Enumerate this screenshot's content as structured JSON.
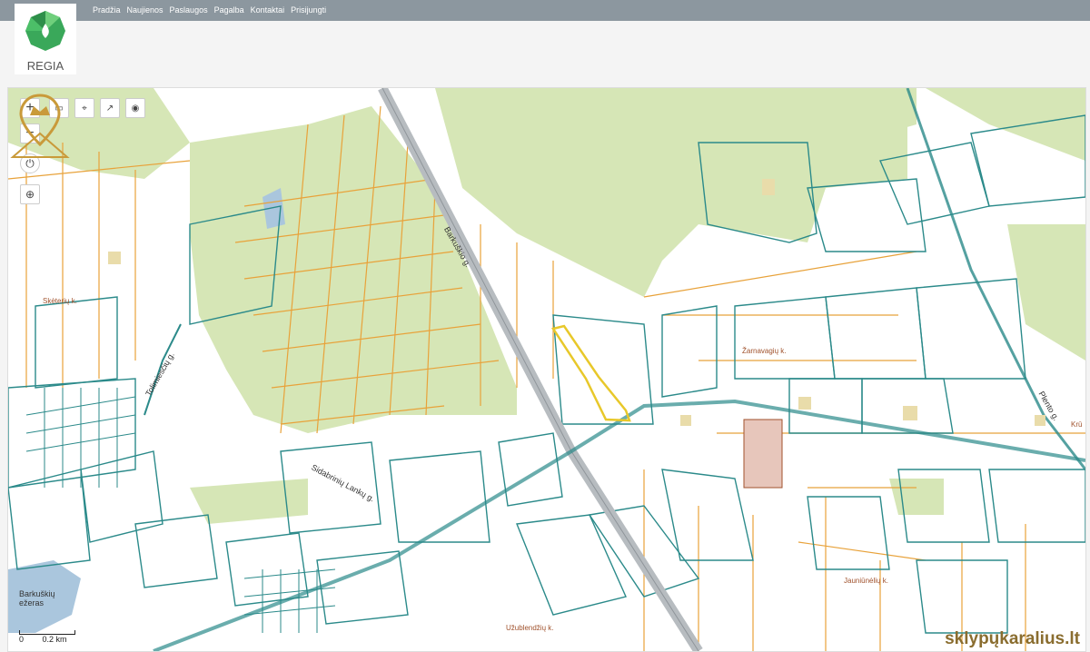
{
  "nav": [
    "Pradžia",
    "Naujienos",
    "Paslaugos",
    "Pagalba",
    "Kontaktai",
    "Prisijungti"
  ],
  "logo_text": "REGIA",
  "roads": {
    "main": "Barkuškio g.",
    "secondary1": "Sidabrinių Lankų g.",
    "secondary2": "Plento g.",
    "secondary3": "Tolimiesčių g."
  },
  "places": {
    "skeriu": "Skėterių k.",
    "zarnavagiu": "Žarnavagių k.",
    "jauniunelu": "Jauniūnėlių k.",
    "uzublendziu": "Užublendžių k.",
    "kru": "Krū"
  },
  "lake": "Barkuškių ežeras",
  "scale": {
    "zero": "0",
    "dist": "0.2 km"
  },
  "brand": "sklypųkaralius.lt",
  "colors": {
    "forest": "#d6e6b6",
    "orange": "#e8a23a",
    "teal": "#2b8a8a",
    "road": "#b7bcc0",
    "highlight": "#e8c82a"
  }
}
